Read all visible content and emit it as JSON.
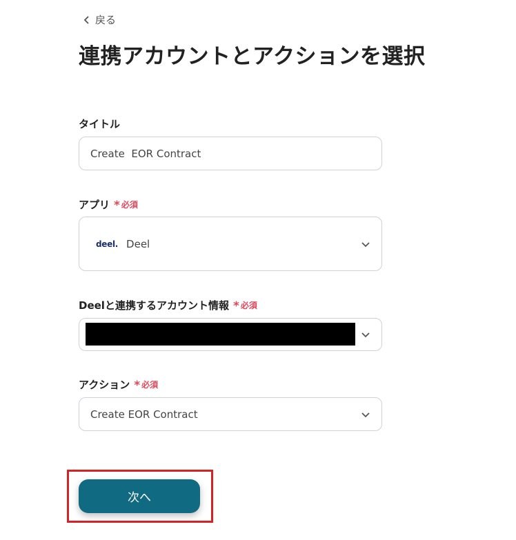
{
  "back": {
    "label": "戻る"
  },
  "page_title": "連携アカウントとアクションを選択",
  "title_field": {
    "label": "タイトル",
    "value": "Create  EOR Contract"
  },
  "app_field": {
    "label": "アプリ",
    "required": "必須",
    "logo_text": "deel.",
    "value": "Deel"
  },
  "account_field": {
    "label": "Deelと連携するアカウント情報",
    "required": "必須"
  },
  "action_field": {
    "label": "アクション",
    "required": "必須",
    "value": "Create EOR Contract"
  },
  "next_button": {
    "label": "次へ"
  },
  "colors": {
    "accent": "#0f6a82",
    "required": "#e0475b",
    "highlight": "#d62222"
  }
}
